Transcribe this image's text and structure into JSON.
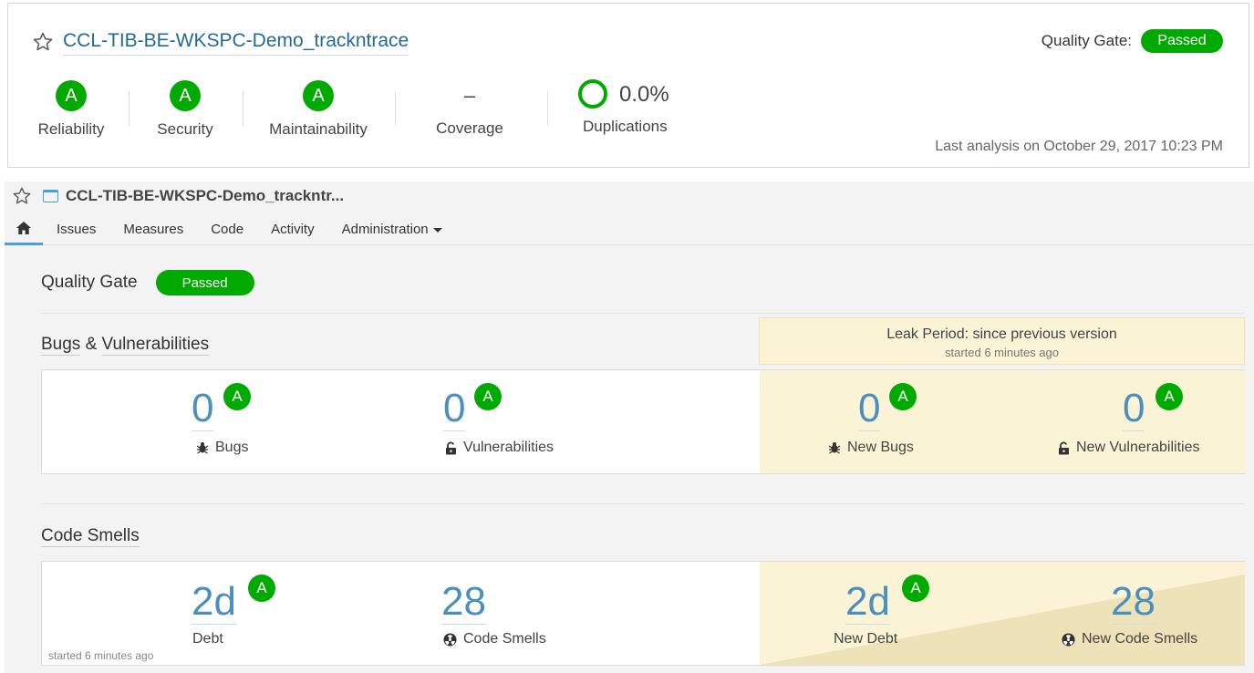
{
  "top_card": {
    "project_name": "CCL-TIB-BE-WKSPC-Demo_trackntrace",
    "quality_gate_label": "Quality Gate:",
    "quality_gate_status": "Passed",
    "metrics": [
      {
        "label": "Reliability",
        "rating": "A"
      },
      {
        "label": "Security",
        "rating": "A"
      },
      {
        "label": "Maintainability",
        "rating": "A"
      },
      {
        "label": "Coverage",
        "value": "–"
      }
    ],
    "duplications": {
      "label": "Duplications",
      "value": "0.0%"
    },
    "last_analysis": "Last analysis on October 29, 2017 10:23 PM"
  },
  "project_header": {
    "name": "CCL-TIB-BE-WKSPC-Demo_trackntr..."
  },
  "nav": {
    "items": [
      "Issues",
      "Measures",
      "Code",
      "Activity",
      "Administration"
    ]
  },
  "overview": {
    "quality_gate_label": "Quality Gate",
    "quality_gate_status": "Passed",
    "leak_period": {
      "title": "Leak Period: since previous version",
      "subtitle": "started 6 minutes ago"
    },
    "bugs_section": {
      "title_part1": "Bugs",
      "title_amp": " & ",
      "title_part2": "Vulnerabilities",
      "bugs": {
        "value": "0",
        "rating": "A",
        "label": "Bugs"
      },
      "vulnerabilities": {
        "value": "0",
        "rating": "A",
        "label": "Vulnerabilities"
      },
      "new_bugs": {
        "value": "0",
        "rating": "A",
        "label": "New Bugs"
      },
      "new_vulnerabilities": {
        "value": "0",
        "rating": "A",
        "label": "New Vulnerabilities"
      }
    },
    "code_smells_section": {
      "title": "Code Smells",
      "debt": {
        "value": "2d",
        "rating": "A",
        "label": "Debt"
      },
      "code_smells": {
        "value": "28",
        "label": "Code Smells"
      },
      "new_debt": {
        "value": "2d",
        "rating": "A",
        "label": "New Debt"
      },
      "new_code_smells": {
        "value": "28",
        "label": "New Code Smells"
      },
      "started_note": "started 6 minutes ago"
    }
  },
  "colors": {
    "passed_green": "#00aa00",
    "link_blue": "#236a97",
    "measure_blue": "#4b8fbf",
    "leak_yellow": "#fbf3d5",
    "leak_diagonal": "#eee2b8"
  }
}
